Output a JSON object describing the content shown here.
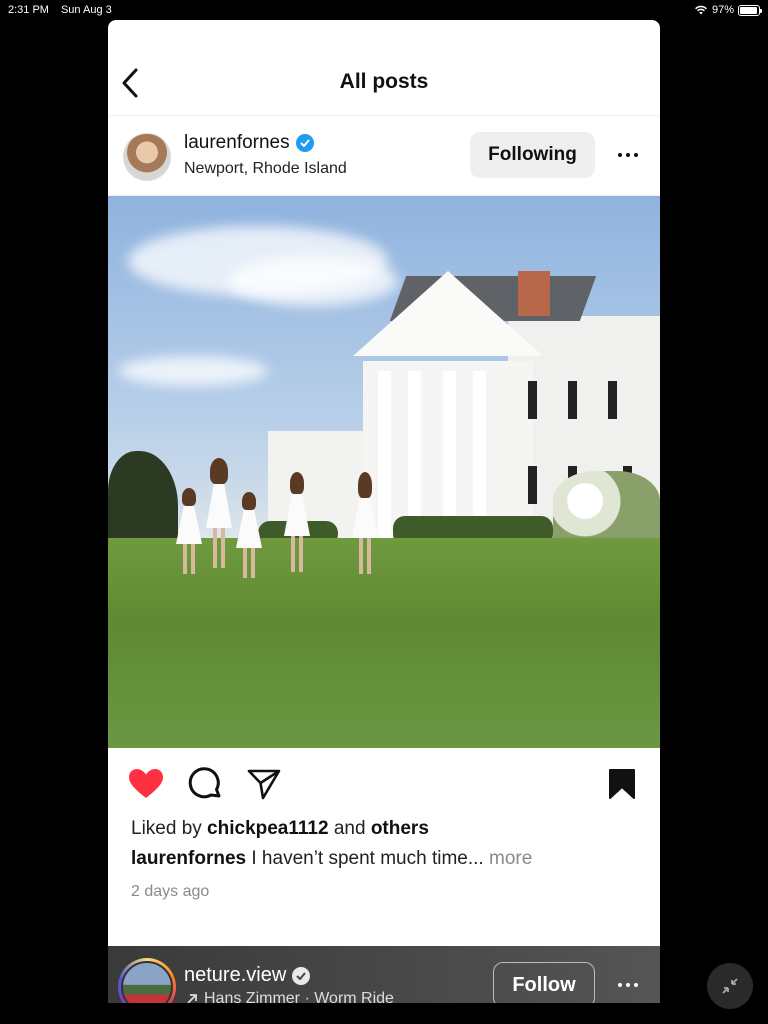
{
  "status_bar": {
    "time": "2:31 PM",
    "date": "Sun Aug 3",
    "battery_label": "97%",
    "battery_level": 0.97
  },
  "nav": {
    "title": "All posts",
    "back_icon": "chevron-left-icon"
  },
  "post": {
    "username": "laurenfornes",
    "location": "Newport, Rhode Island",
    "follow_state_label": "Following",
    "image_alt": "Girls in white dresses running on lawn toward white mansion",
    "liked": true,
    "saved": true,
    "likes": {
      "prefix": "Liked by ",
      "user": "chickpea1112",
      "middle": " and ",
      "others": "others"
    },
    "caption": {
      "user": "laurenfornes",
      "text": " I haven’t spent much time...",
      "more": " more"
    },
    "timestamp": "2 days ago"
  },
  "next_post": {
    "username": "neture.view",
    "audio": "Hans Zimmer · Worm Ride",
    "follow_label": "Follow"
  },
  "colors": {
    "like_red": "#ff3040",
    "verified_blue": "#1f9bf0",
    "following_bg": "#efefef",
    "muted_text": "#8a8a8a"
  }
}
